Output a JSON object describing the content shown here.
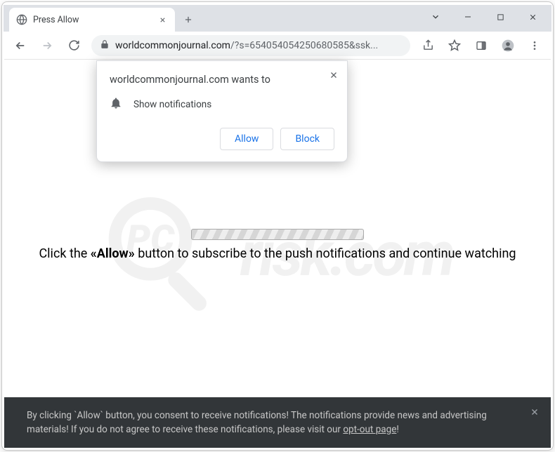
{
  "tab": {
    "title": "Press Allow"
  },
  "omnibox": {
    "domain": "worldcommonjournal.com",
    "path": "/?s=654054054250680585&ssk..."
  },
  "permission": {
    "host": "worldcommonjournal.com wants to",
    "label": "Show notifications",
    "allow": "Allow",
    "block": "Block"
  },
  "page": {
    "prefix": "Click the ",
    "bold": "«Allow»",
    "suffix": " button to subscribe to the push notifications and continue watching"
  },
  "consent": {
    "line1": "By clicking `Allow` button, you consent to receive notifications! The notifications provide news and advertising",
    "line2a": "materials! If you do not agree to receive these notifications, please visit our ",
    "link": "opt-out page",
    "line2b": "!"
  },
  "watermark": {
    "text": "risk.com"
  }
}
